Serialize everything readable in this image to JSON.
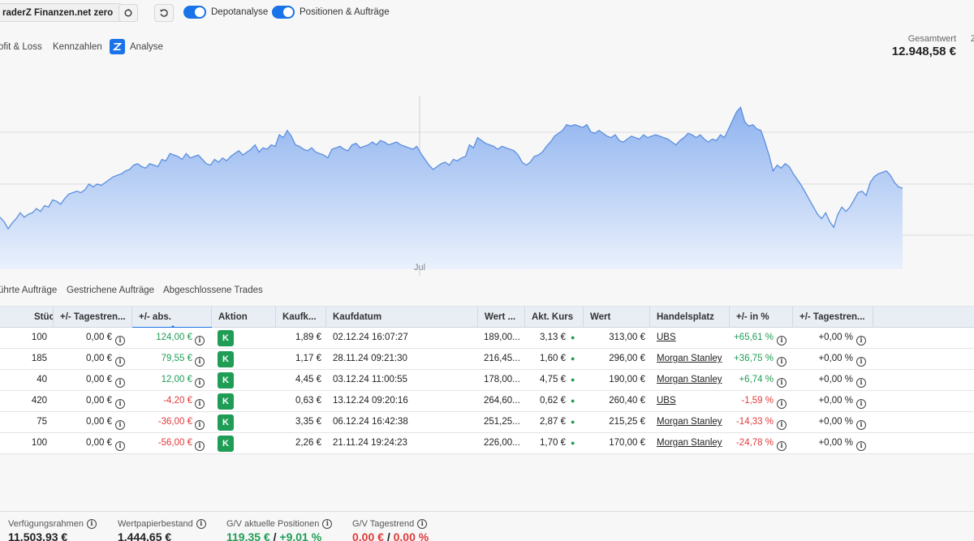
{
  "toolbar": {
    "broker_label": "raderZ Finanzen.net zero",
    "toggle_depot_label": "Depotanalyse",
    "toggle_positions_label": "Positionen & Aufträge"
  },
  "tabs": {
    "pl": "ofit & Loss",
    "kennzahlen": "Kennzahlen",
    "analyse": "Analyse"
  },
  "summary": {
    "gesamtwert_label": "Gesamtwert",
    "gesamtwert_value": "12.948,58 €",
    "edge_mark": "Z"
  },
  "chart_data": {
    "type": "area",
    "x_tick_labels": [
      "Jul"
    ],
    "values": [
      186,
      183,
      178,
      182,
      185,
      189,
      186,
      188,
      189,
      192,
      190,
      194,
      193,
      198,
      197,
      195,
      199,
      202,
      203,
      204,
      203,
      205,
      209,
      207,
      209,
      208,
      210,
      212,
      214,
      215,
      216,
      218,
      219,
      222,
      223,
      221,
      220,
      223,
      222,
      221,
      226,
      225,
      230,
      229,
      228,
      226,
      230,
      227,
      228,
      229,
      226,
      223,
      222,
      226,
      224,
      227,
      225,
      228,
      230,
      232,
      229,
      231,
      233,
      236,
      231,
      234,
      233,
      236,
      235,
      243,
      241,
      246,
      242,
      236,
      235,
      233,
      232,
      234,
      231,
      230,
      229,
      227,
      233,
      234,
      235,
      233,
      232,
      236,
      237,
      234,
      235,
      236,
      238,
      236,
      239,
      238,
      236,
      237,
      238,
      236,
      235,
      234,
      233,
      235,
      230,
      226,
      222,
      219,
      221,
      223,
      224,
      222,
      226,
      225,
      227,
      228,
      236,
      234,
      241,
      239,
      237,
      236,
      235,
      233,
      235,
      234,
      233,
      232,
      229,
      224,
      222,
      224,
      228,
      229,
      231,
      235,
      238,
      242,
      244,
      246,
      250,
      249,
      250,
      249,
      248,
      250,
      245,
      244,
      246,
      244,
      242,
      241,
      243,
      239,
      238,
      240,
      242,
      241,
      240,
      243,
      241,
      242,
      243,
      242,
      241,
      240,
      238,
      236,
      239,
      241,
      244,
      243,
      241,
      243,
      240,
      238,
      240,
      239,
      243,
      241,
      247,
      253,
      259,
      262,
      252,
      249,
      250,
      247,
      246,
      238,
      229,
      218,
      222,
      220,
      223,
      221,
      216,
      212,
      208,
      203,
      198,
      193,
      188,
      185,
      189,
      183,
      179,
      188,
      193,
      190,
      193,
      198,
      203,
      204,
      201,
      210,
      214,
      216,
      217,
      218,
      215,
      210,
      207,
      206
    ],
    "ylim": [
      150,
      270
    ],
    "gridlines": true,
    "legend": "none"
  },
  "order_tabs": {
    "t1": "ührte Aufträge",
    "t2": "Gestrichene Aufträge",
    "t3": "Abgeschlossene Trades"
  },
  "table": {
    "headers": {
      "stueck": "Stück...",
      "tagestrend": "+/- Tagestren...",
      "abs": "+/- abs.",
      "aktion": "Aktion",
      "kaufk": "Kaufk...",
      "kaufdatum": "Kaufdatum",
      "wert_trunc": "Wert ...",
      "aktkurs": "Akt. Kurs",
      "wert": "Wert",
      "handelsplatz": "Handelsplatz",
      "pct": "+/- in %",
      "tagestrend_pct": "+/- Tagestren..."
    },
    "rows": [
      {
        "stueck": "100",
        "tagestrend": "0,00 €",
        "abs": "124,00 €",
        "abs_sign": "pos",
        "aktion": "K",
        "kaufk": "1,89 €",
        "kaufdatum": "02.12.24 16:07:27",
        "wert_trunc": "189,00...",
        "aktkurs": "3,13 €",
        "wert": "313,00 €",
        "handelsplatz": "UBS",
        "pct": "+65,61 %",
        "pct_sign": "pos",
        "tagestrend_pct": "+0,00 %"
      },
      {
        "stueck": "185",
        "tagestrend": "0,00 €",
        "abs": "79,55 €",
        "abs_sign": "pos",
        "aktion": "K",
        "kaufk": "1,17 €",
        "kaufdatum": "28.11.24 09:21:30",
        "wert_trunc": "216,45...",
        "aktkurs": "1,60 €",
        "wert": "296,00 €",
        "handelsplatz": "Morgan Stanley",
        "pct": "+36,75 %",
        "pct_sign": "pos",
        "tagestrend_pct": "+0,00 %"
      },
      {
        "stueck": "40",
        "tagestrend": "0,00 €",
        "abs": "12,00 €",
        "abs_sign": "pos",
        "aktion": "K",
        "kaufk": "4,45 €",
        "kaufdatum": "03.12.24 11:00:55",
        "wert_trunc": "178,00...",
        "aktkurs": "4,75 €",
        "wert": "190,00 €",
        "handelsplatz": "Morgan Stanley",
        "pct": "+6,74 %",
        "pct_sign": "pos",
        "tagestrend_pct": "+0,00 %"
      },
      {
        "stueck": "420",
        "tagestrend": "0,00 €",
        "abs": "-4,20 €",
        "abs_sign": "neg",
        "aktion": "K",
        "kaufk": "0,63 €",
        "kaufdatum": "13.12.24 09:20:16",
        "wert_trunc": "264,60...",
        "aktkurs": "0,62 €",
        "wert": "260,40 €",
        "handelsplatz": "UBS",
        "pct": "-1,59 %",
        "pct_sign": "neg",
        "tagestrend_pct": "+0,00 %"
      },
      {
        "stueck": "75",
        "tagestrend": "0,00 €",
        "abs": "-36,00 €",
        "abs_sign": "neg",
        "aktion": "K",
        "kaufk": "3,35 €",
        "kaufdatum": "06.12.24 16:42:38",
        "wert_trunc": "251,25...",
        "aktkurs": "2,87 €",
        "wert": "215,25 €",
        "handelsplatz": "Morgan Stanley",
        "pct": "-14,33 %",
        "pct_sign": "neg",
        "tagestrend_pct": "+0,00 %"
      },
      {
        "stueck": "100",
        "tagestrend": "0,00 €",
        "abs": "-56,00 €",
        "abs_sign": "neg",
        "aktion": "K",
        "kaufk": "2,26 €",
        "kaufdatum": "21.11.24 19:24:23",
        "wert_trunc": "226,00...",
        "aktkurs": "1,70 €",
        "wert": "170,00 €",
        "handelsplatz": "Morgan Stanley",
        "pct": "-24,78 %",
        "pct_sign": "neg",
        "tagestrend_pct": "+0,00 %"
      }
    ]
  },
  "footer": {
    "verfuegung_label": "Verfügungsrahmen",
    "verfuegung_value": "11.503,93 €",
    "wertpapier_label": "Wertpapierbestand",
    "wertpapier_value": "1.444,65 €",
    "gv_pos_label": "G/V aktuelle Positionen",
    "gv_pos_abs": "119,35 €",
    "gv_pos_sep": " / ",
    "gv_pos_pct": "+9,01 %",
    "gv_tag_label": "G/V Tagestrend",
    "gv_tag_abs": "0,00 €",
    "gv_tag_sep": " / ",
    "gv_tag_pct": "0,00 %"
  },
  "colors": {
    "accent": "#1a73e8",
    "positive": "#1f9d55",
    "negative": "#e03a3a",
    "chart_line": "#5b8fe0",
    "chart_fill_top": "#8fb3ef",
    "chart_fill_bottom": "#eaf1fc"
  }
}
